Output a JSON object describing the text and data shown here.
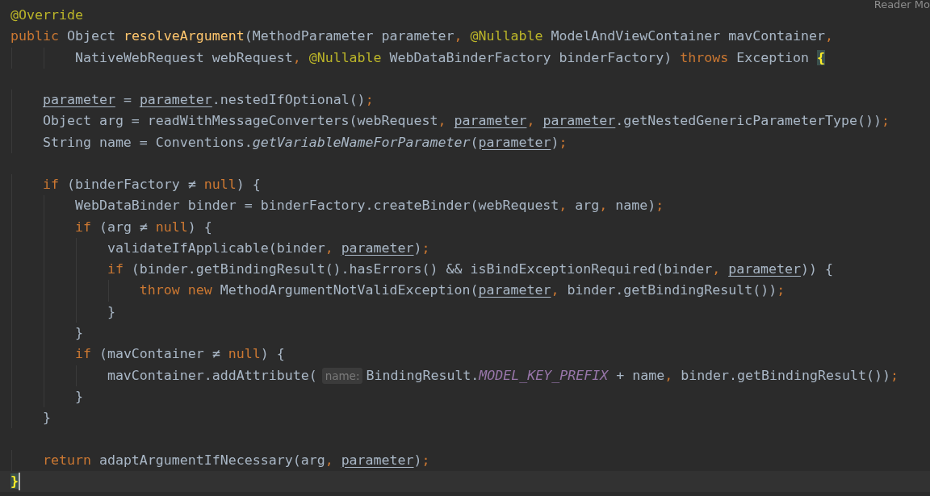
{
  "reader_mode": {
    "label": "Reader Mo"
  },
  "lines": [
    {
      "kind": "code",
      "current": false,
      "tokens": [
        {
          "kind": "annotation",
          "text": "@Override"
        }
      ]
    },
    {
      "kind": "code",
      "current": false,
      "tokens": [
        {
          "kind": "keyword",
          "text": "public"
        },
        {
          "kind": "plain",
          "text": " Object "
        },
        {
          "kind": "declaration",
          "text": "resolveArgument"
        },
        {
          "kind": "plain",
          "text": "(MethodParameter parameter"
        },
        {
          "kind": "punct",
          "text": ", "
        },
        {
          "kind": "annotation",
          "text": "@Nullable"
        },
        {
          "kind": "plain",
          "text": " ModelAndViewContainer mavContainer"
        },
        {
          "kind": "punct",
          "text": ","
        }
      ]
    },
    {
      "kind": "code",
      "current": false,
      "tokens": [
        {
          "kind": "plain",
          "text": "        NativeWebRequest webRequest"
        },
        {
          "kind": "punct",
          "text": ", "
        },
        {
          "kind": "annotation",
          "text": "@Nullable"
        },
        {
          "kind": "plain",
          "text": " WebDataBinderFactory binderFactory) "
        },
        {
          "kind": "keyword",
          "text": "throws"
        },
        {
          "kind": "plain",
          "text": " Exception "
        },
        {
          "kind": "brace",
          "text": "{"
        }
      ]
    },
    {
      "kind": "blank",
      "current": false
    },
    {
      "kind": "code",
      "current": false,
      "tokens": [
        {
          "kind": "param",
          "text": "    parameter"
        },
        {
          "kind": "plain",
          "text": " = "
        },
        {
          "kind": "param",
          "text": "parameter"
        },
        {
          "kind": "plain",
          "text": ".nestedIfOptional()"
        },
        {
          "kind": "punct",
          "text": ";"
        }
      ]
    },
    {
      "kind": "code",
      "current": false,
      "tokens": [
        {
          "kind": "plain",
          "text": "    Object arg = readWithMessageConverters(webRequest"
        },
        {
          "kind": "punct",
          "text": ", "
        },
        {
          "kind": "param",
          "text": "parameter"
        },
        {
          "kind": "punct",
          "text": ", "
        },
        {
          "kind": "param",
          "text": "parameter"
        },
        {
          "kind": "plain",
          "text": ".getNestedGenericParameterType())"
        },
        {
          "kind": "punct",
          "text": ";"
        }
      ]
    },
    {
      "kind": "code",
      "current": false,
      "tokens": [
        {
          "kind": "plain",
          "text": "    String name = Conventions."
        },
        {
          "kind": "static",
          "text": "getVariableNameForParameter"
        },
        {
          "kind": "plain",
          "text": "("
        },
        {
          "kind": "param",
          "text": "parameter"
        },
        {
          "kind": "plain",
          "text": ")"
        },
        {
          "kind": "punct",
          "text": ";"
        }
      ]
    },
    {
      "kind": "blank",
      "current": false
    },
    {
      "kind": "code",
      "current": false,
      "tokens": [
        {
          "kind": "keyword",
          "text": "    if"
        },
        {
          "kind": "plain",
          "text": " (binderFactory ≠ "
        },
        {
          "kind": "keyword",
          "text": "null"
        },
        {
          "kind": "plain",
          "text": ") {"
        }
      ]
    },
    {
      "kind": "code",
      "current": false,
      "tokens": [
        {
          "kind": "plain",
          "text": "        WebDataBinder binder = binderFactory.createBinder(webRequest"
        },
        {
          "kind": "punct",
          "text": ","
        },
        {
          "kind": "plain",
          "text": " arg"
        },
        {
          "kind": "punct",
          "text": ","
        },
        {
          "kind": "plain",
          "text": " name)"
        },
        {
          "kind": "punct",
          "text": ";"
        }
      ]
    },
    {
      "kind": "code",
      "current": false,
      "tokens": [
        {
          "kind": "keyword",
          "text": "        if"
        },
        {
          "kind": "plain",
          "text": " (arg ≠ "
        },
        {
          "kind": "keyword",
          "text": "null"
        },
        {
          "kind": "plain",
          "text": ") {"
        }
      ]
    },
    {
      "kind": "code",
      "current": false,
      "tokens": [
        {
          "kind": "plain",
          "text": "            validateIfApplicable(binder"
        },
        {
          "kind": "punct",
          "text": ", "
        },
        {
          "kind": "param",
          "text": "parameter"
        },
        {
          "kind": "plain",
          "text": ")"
        },
        {
          "kind": "punct",
          "text": ";"
        }
      ]
    },
    {
      "kind": "code",
      "current": false,
      "tokens": [
        {
          "kind": "keyword",
          "text": "            if"
        },
        {
          "kind": "plain",
          "text": " (binder.getBindingResult().hasErrors() && isBindExceptionRequired(binder"
        },
        {
          "kind": "punct",
          "text": ", "
        },
        {
          "kind": "param",
          "text": "parameter"
        },
        {
          "kind": "plain",
          "text": ")) {"
        }
      ]
    },
    {
      "kind": "code",
      "current": false,
      "tokens": [
        {
          "kind": "keyword",
          "text": "                throw new"
        },
        {
          "kind": "plain",
          "text": " MethodArgumentNotValidException("
        },
        {
          "kind": "param",
          "text": "parameter"
        },
        {
          "kind": "punct",
          "text": ","
        },
        {
          "kind": "plain",
          "text": " binder.getBindingResult())"
        },
        {
          "kind": "punct",
          "text": ";"
        }
      ]
    },
    {
      "kind": "code",
      "current": false,
      "tokens": [
        {
          "kind": "plain",
          "text": "            }"
        }
      ]
    },
    {
      "kind": "code",
      "current": false,
      "tokens": [
        {
          "kind": "plain",
          "text": "        }"
        }
      ]
    },
    {
      "kind": "code",
      "current": false,
      "tokens": [
        {
          "kind": "keyword",
          "text": "        if"
        },
        {
          "kind": "plain",
          "text": " (mavContainer ≠ "
        },
        {
          "kind": "keyword",
          "text": "null"
        },
        {
          "kind": "plain",
          "text": ") {"
        }
      ]
    },
    {
      "kind": "code",
      "current": false,
      "tokens": [
        {
          "kind": "plain",
          "text": "            mavContainer.addAttribute("
        },
        {
          "kind": "hint",
          "text": "name:"
        },
        {
          "kind": "plain",
          "text": "BindingResult."
        },
        {
          "kind": "constant",
          "text": "MODEL_KEY_PREFIX"
        },
        {
          "kind": "plain",
          "text": " + name"
        },
        {
          "kind": "punct",
          "text": ","
        },
        {
          "kind": "plain",
          "text": " binder.getBindingResult())"
        },
        {
          "kind": "punct",
          "text": ";"
        }
      ]
    },
    {
      "kind": "code",
      "current": false,
      "tokens": [
        {
          "kind": "plain",
          "text": "        }"
        }
      ]
    },
    {
      "kind": "code",
      "current": false,
      "tokens": [
        {
          "kind": "plain",
          "text": "    }"
        }
      ]
    },
    {
      "kind": "blank",
      "current": false
    },
    {
      "kind": "code",
      "current": false,
      "tokens": [
        {
          "kind": "keyword",
          "text": "    return"
        },
        {
          "kind": "plain",
          "text": " adaptArgumentIfNecessary(arg"
        },
        {
          "kind": "punct",
          "text": ", "
        },
        {
          "kind": "param",
          "text": "parameter"
        },
        {
          "kind": "plain",
          "text": ")"
        },
        {
          "kind": "punct",
          "text": ";"
        }
      ]
    },
    {
      "kind": "code",
      "current": true,
      "tokens": [
        {
          "kind": "brace",
          "text": "}"
        }
      ]
    }
  ]
}
